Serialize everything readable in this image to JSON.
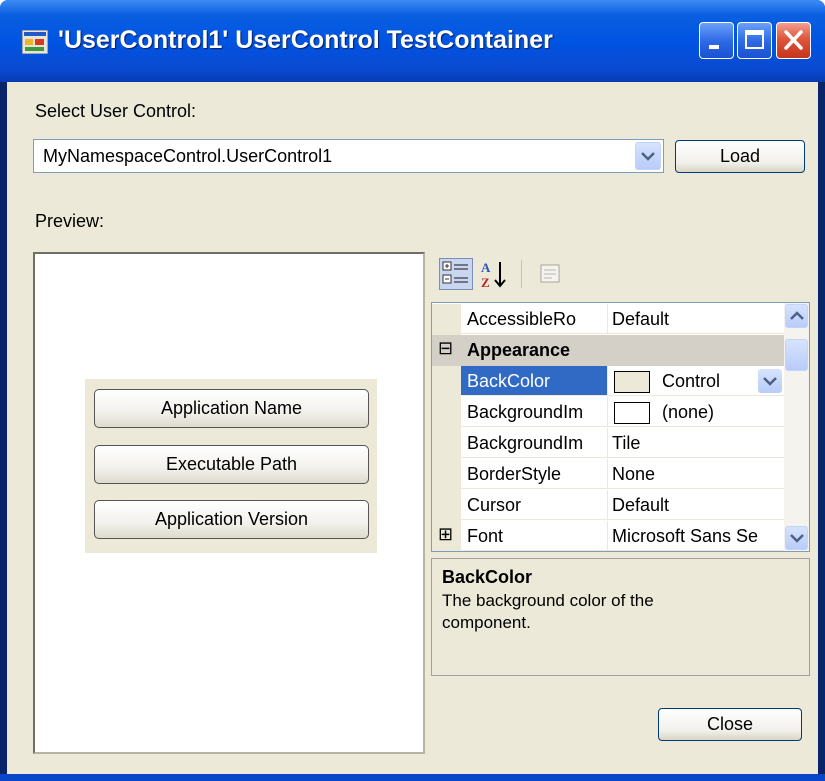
{
  "window": {
    "title": "'UserControl1' UserControl TestContainer"
  },
  "select": {
    "label": "Select User Control:",
    "value": "MyNamespaceControl.UserControl1",
    "load_label": "Load"
  },
  "preview": {
    "label": "Preview:",
    "buttons": [
      "Application Name",
      "Executable Path",
      "Application Version"
    ]
  },
  "propertygrid": {
    "rows": [
      {
        "type": "prop",
        "name": "AccessibleRo",
        "value": "Default"
      },
      {
        "type": "category",
        "name": "Appearance",
        "glyph": "⊟"
      },
      {
        "type": "prop",
        "name": "BackColor",
        "value": "Control",
        "selected": true,
        "swatch": "#ece9d8"
      },
      {
        "type": "prop",
        "name": "BackgroundIm",
        "value": "(none)",
        "swatch": "#ffffff"
      },
      {
        "type": "prop",
        "name": "BackgroundIm",
        "value": "Tile"
      },
      {
        "type": "prop",
        "name": "BorderStyle",
        "value": "None"
      },
      {
        "type": "prop",
        "name": "Cursor",
        "value": "Default"
      },
      {
        "type": "prop",
        "name": "Font",
        "value": "Microsoft Sans Se",
        "expand": "⊞"
      }
    ]
  },
  "description": {
    "title": "BackColor",
    "text": "The background color of the component."
  },
  "footer": {
    "close_label": "Close"
  },
  "colors": {
    "selection": "#316ac5",
    "category": "#d4d0c8",
    "title_blue": "#0054e3"
  }
}
